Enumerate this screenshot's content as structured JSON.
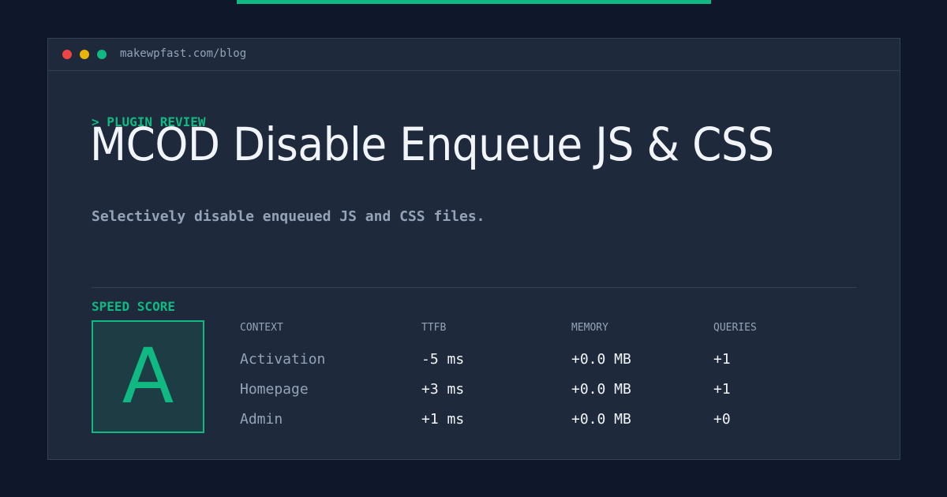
{
  "window": {
    "url": "makewpfast.com/blog"
  },
  "header": {
    "kicker": "> PLUGIN REVIEW",
    "title": "MCOD Disable Enqueue JS & CSS",
    "subtitle": "Selectively disable enqueued JS and CSS files."
  },
  "score": {
    "label": "SPEED SCORE",
    "grade": "A"
  },
  "table": {
    "headers": {
      "context": "CONTEXT",
      "ttfb": "TTFB",
      "memory": "MEMORY",
      "queries": "QUERIES"
    },
    "rows": [
      {
        "context": "Activation",
        "ttfb": "-5 ms",
        "memory": "+0.0 MB",
        "queries": "+1"
      },
      {
        "context": "Homepage",
        "ttfb": "+3 ms",
        "memory": "+0.0 MB",
        "queries": "+1"
      },
      {
        "context": "Admin",
        "ttfb": "+1 ms",
        "memory": "+0.0 MB",
        "queries": "+0"
      }
    ]
  },
  "colors": {
    "background": "#0f172a",
    "panel": "#1e293b",
    "accent": "#10b981",
    "muted_text": "#94a3b8",
    "bright_text": "#f1f5f9",
    "dot_red": "#ef4444",
    "dot_yellow": "#eab308",
    "dot_green": "#10b981"
  }
}
